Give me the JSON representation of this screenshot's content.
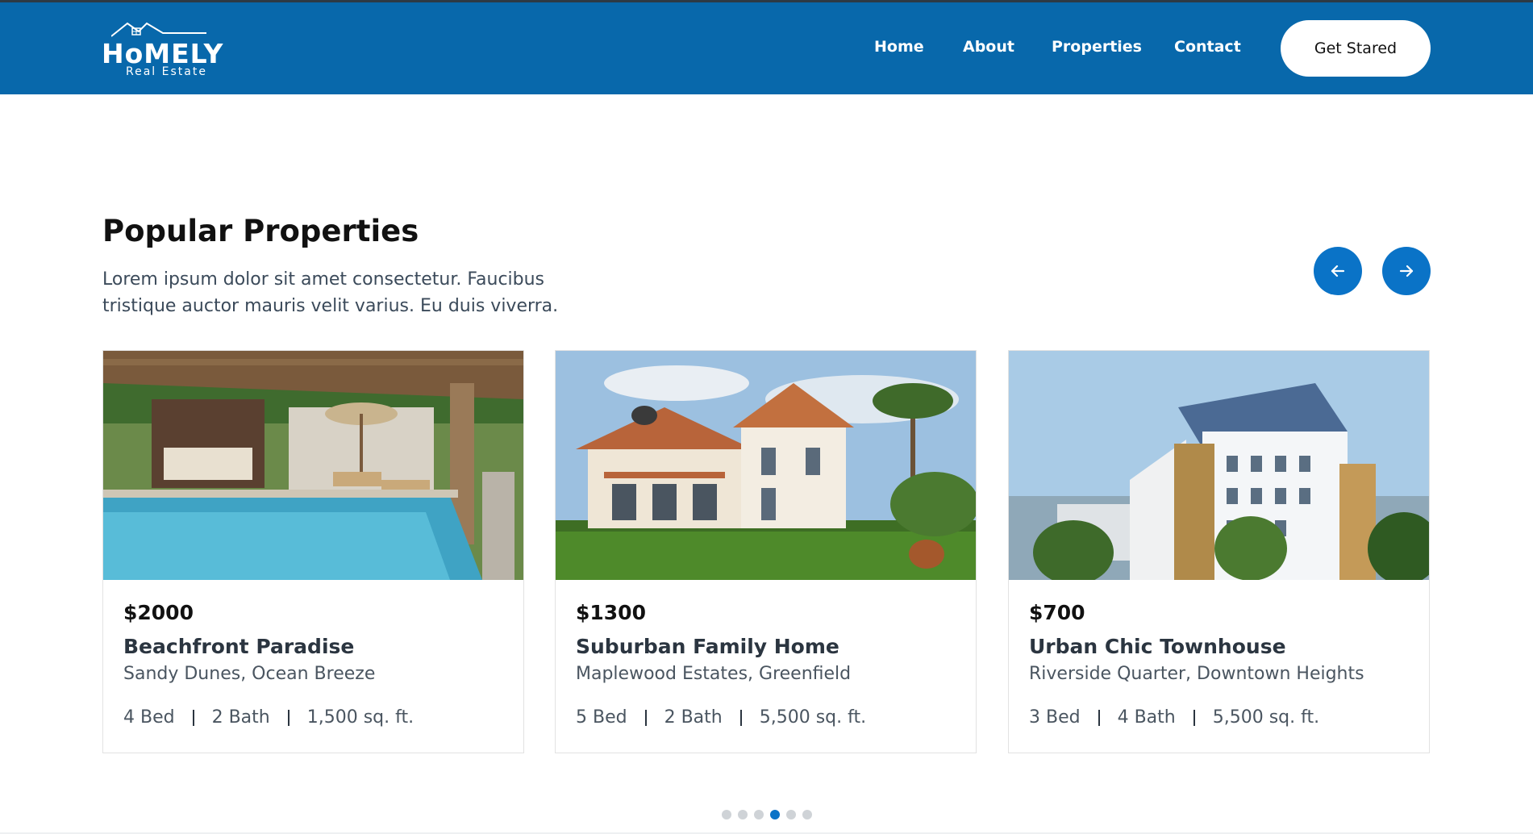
{
  "brand": {
    "name": "HoMELY",
    "tagline": "Real Estate"
  },
  "nav": {
    "links": [
      {
        "label": "Home"
      },
      {
        "label": "About"
      },
      {
        "label": "Properties"
      },
      {
        "label": "Contact"
      }
    ],
    "cta_label": "Get Stared"
  },
  "section": {
    "title": "Popular Properties",
    "description": "Lorem ipsum dolor sit amet consectetur. Faucibus tristique auctor mauris velit varius. Eu duis viverra."
  },
  "carousel": {
    "prev_icon": "arrow-left-icon",
    "next_icon": "arrow-right-icon",
    "dot_count": 6,
    "active_dot": 4
  },
  "properties": [
    {
      "price": "$2000",
      "name": "Beachfront Paradise",
      "location": "Sandy Dunes, Ocean Breeze",
      "beds": "4 Bed",
      "baths": "2 Bath",
      "area": "1,500 sq. ft."
    },
    {
      "price": "$1300",
      "name": "Suburban Family Home",
      "location": "Maplewood Estates, Greenfield",
      "beds": "5 Bed",
      "baths": "2 Bath",
      "area": "5,500 sq. ft."
    },
    {
      "price": "$700",
      "name": "Urban Chic Townhouse",
      "location": "Riverside Quarter, Downtown Heights",
      "beds": "3 Bed",
      "baths": "4 Bath",
      "area": "5,500 sq. ft."
    }
  ],
  "colors": {
    "header": "#0868ab",
    "accent": "#0a73c7",
    "text_dark": "#111111",
    "text_muted": "#4a5560"
  }
}
